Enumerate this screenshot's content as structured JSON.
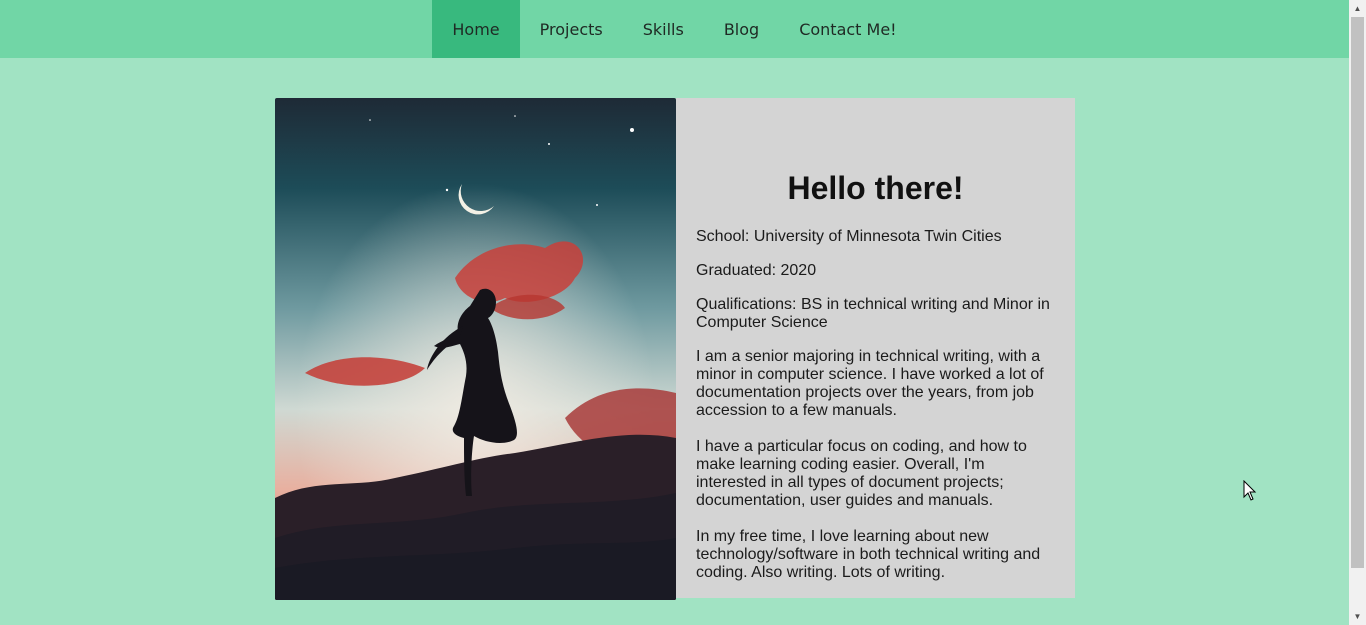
{
  "nav": {
    "items": [
      {
        "label": "Home",
        "active": true
      },
      {
        "label": "Projects",
        "active": false
      },
      {
        "label": "Skills",
        "active": false
      },
      {
        "label": "Blog",
        "active": false
      },
      {
        "label": "Contact Me!",
        "active": false
      }
    ]
  },
  "profile": {
    "heading": "Hello there!",
    "school": "School: University of Minnesota Twin Cities",
    "graduated": "Graduated: 2020",
    "qualifications": "Qualifications: BS in technical writing and Minor in Computer Science",
    "bio1": "I am a senior majoring in technical writing, with a minor in computer science. I have worked a lot of documentation projects over the years, from job accession to a few manuals.",
    "bio2": "I have a particular focus on coding, and how to make learning coding easier. Overall, I'm interested in all types of document projects; documentation, user guides and manuals.",
    "bio3": "In my free time, I love learning about new technology/software in both technical writing and coding. Also writing. Lots of writing."
  },
  "colors": {
    "page_bg": "#a1e3c3",
    "nav_bg": "#71d6a6",
    "nav_active": "#38b97e",
    "card_bg": "#d4d4d4"
  },
  "icons": {
    "photo": "silhouette-under-moon-image",
    "cursor": "mouse-pointer-icon"
  }
}
